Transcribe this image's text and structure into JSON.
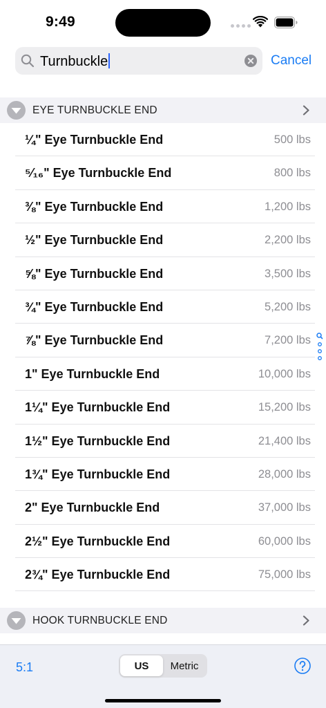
{
  "status": {
    "time": "9:49"
  },
  "search": {
    "query": "Turnbuckle",
    "cancel_label": "Cancel"
  },
  "sections": [
    {
      "title": "EYE TURNBUCKLE END",
      "rows": [
        {
          "name": "¼\" Eye Turnbuckle End",
          "value": "500 lbs"
        },
        {
          "name": "⁵⁄₁₆\" Eye Turnbuckle End",
          "value": "800 lbs"
        },
        {
          "name": "⅜\" Eye Turnbuckle End",
          "value": "1,200 lbs"
        },
        {
          "name": "½\" Eye Turnbuckle End",
          "value": "2,200 lbs"
        },
        {
          "name": "⅝\" Eye Turnbuckle End",
          "value": "3,500 lbs"
        },
        {
          "name": "¾\" Eye Turnbuckle End",
          "value": "5,200 lbs"
        },
        {
          "name": "⅞\" Eye Turnbuckle End",
          "value": "7,200 lbs"
        },
        {
          "name": "1\" Eye Turnbuckle End",
          "value": "10,000 lbs"
        },
        {
          "name": "1¼\" Eye Turnbuckle End",
          "value": "15,200 lbs"
        },
        {
          "name": "1½\" Eye Turnbuckle End",
          "value": "21,400 lbs"
        },
        {
          "name": "1¾\" Eye Turnbuckle End",
          "value": "28,000 lbs"
        },
        {
          "name": "2\" Eye Turnbuckle End",
          "value": "37,000 lbs"
        },
        {
          "name": "2½\" Eye Turnbuckle End",
          "value": "60,000 lbs"
        },
        {
          "name": "2¾\" Eye Turnbuckle End",
          "value": "75,000 lbs"
        }
      ]
    },
    {
      "title": "HOOK TURNBUCKLE END"
    }
  ],
  "toolbar": {
    "ratio_label": "5:1",
    "units": [
      "US",
      "Metric"
    ],
    "selected_unit": "US"
  },
  "icons": {
    "search": "search-icon",
    "clear": "clear-icon",
    "section_toggle": "chevron-down-circle-icon",
    "section_disclosure": "chevron-right-icon",
    "help": "question-circle-icon",
    "index_search": "magnifier-icon"
  },
  "colors": {
    "accent": "#1a7cf4",
    "secondary_text": "#8e8e93",
    "header_bg": "#f2f2f6"
  }
}
